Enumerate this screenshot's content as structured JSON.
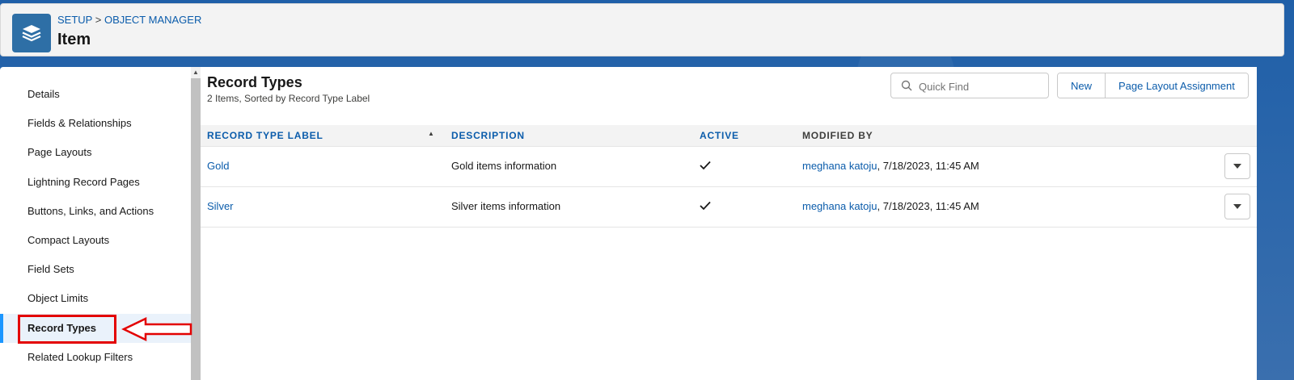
{
  "header": {
    "breadcrumb": [
      "SETUP",
      ">",
      "OBJECT MANAGER"
    ],
    "title": "Item",
    "icon": "layers-icon"
  },
  "sidebar": {
    "items": [
      {
        "label": "Details"
      },
      {
        "label": "Fields & Relationships"
      },
      {
        "label": "Page Layouts"
      },
      {
        "label": "Lightning Record Pages"
      },
      {
        "label": "Buttons, Links, and Actions"
      },
      {
        "label": "Compact Layouts"
      },
      {
        "label": "Field Sets"
      },
      {
        "label": "Object Limits"
      },
      {
        "label": "Record Types",
        "active": true
      },
      {
        "label": "Related Lookup Filters"
      }
    ]
  },
  "main": {
    "title": "Record Types",
    "subtitle": "2 Items, Sorted by Record Type Label",
    "search": {
      "placeholder": "Quick Find",
      "value": ""
    },
    "buttons": {
      "new": "New",
      "assign": "Page Layout Assignment"
    },
    "columns": [
      "RECORD TYPE LABEL",
      "DESCRIPTION",
      "ACTIVE",
      "MODIFIED BY"
    ],
    "rows": [
      {
        "label": "Gold",
        "description": "Gold items information",
        "active": true,
        "modified_by": "meghana katoju",
        "modified_at": ", 7/18/2023, 11:45 AM"
      },
      {
        "label": "Silver",
        "description": "Silver items information",
        "active": true,
        "modified_by": "meghana katoju",
        "modified_at": ", 7/18/2023, 11:45 AM"
      }
    ]
  },
  "colors": {
    "link": "#0b5cab",
    "active_bar": "#1b96ff",
    "annotation": "#e30000",
    "header_icon_bg": "#2e6fa6"
  }
}
